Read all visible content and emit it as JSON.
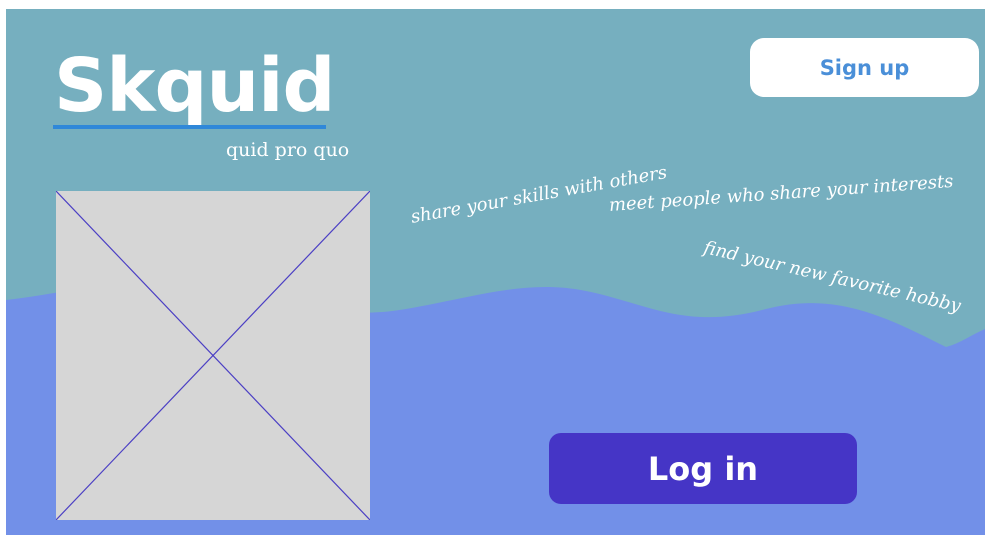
{
  "brand": {
    "logo_text": "Skquid",
    "tagline": "quid pro quo"
  },
  "header": {
    "signup_label": "Sign up"
  },
  "slogans": [
    "share your skills with others",
    "meet people who share your interests",
    "find your new favorite hobby"
  ],
  "actions": {
    "login_label": "Log in"
  },
  "colors": {
    "sky": "#76afbf",
    "wave": "#7290e8",
    "login_button": "#4535c6",
    "signup_text": "#4a8fd8",
    "logo_underline": "#2f88d9",
    "placeholder_fill": "#d6d6d6",
    "placeholder_cross": "#4b3fc4"
  },
  "icons": {
    "image_placeholder": "image-placeholder-icon"
  }
}
